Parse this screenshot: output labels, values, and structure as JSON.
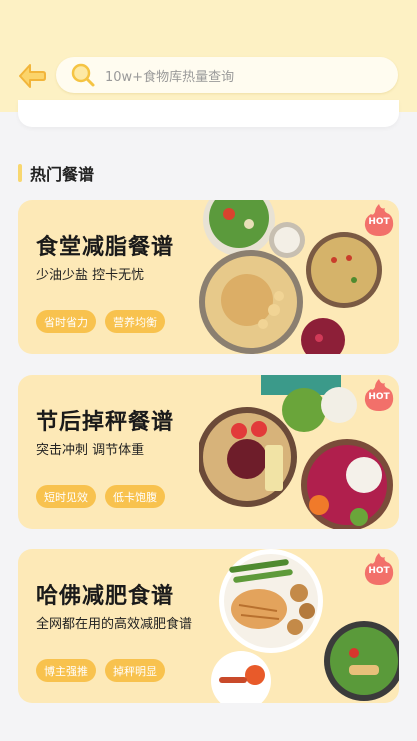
{
  "search": {
    "placeholder": "10w+食物库热量查询"
  },
  "section": {
    "title": "热门餐谱"
  },
  "cards": [
    {
      "title": "食堂减脂餐谱",
      "subtitle": "少油少盐 控卡无忧",
      "tags": [
        "省时省力",
        "营养均衡"
      ],
      "badge": "HOT"
    },
    {
      "title": "节后掉秤餐谱",
      "subtitle": "突击冲刺 调节体重",
      "tags": [
        "短时见效",
        "低卡饱腹"
      ],
      "badge": "HOT"
    },
    {
      "title": "哈佛减肥食谱",
      "subtitle": "全网都在用的高效减肥食谱",
      "tags": [
        "博主强推",
        "掉秤明显"
      ],
      "badge": "HOT"
    }
  ],
  "colors": {
    "header_bg": "#fdf1c4",
    "card_bg": "#fde9b7",
    "tag_bg": "#f8c24e",
    "hot_badge": "#f2706a",
    "accent": "#f8d770"
  },
  "icons": {
    "back": "arrow-left-icon",
    "search": "magnifier-icon",
    "hot": "flame-hot-icon"
  }
}
